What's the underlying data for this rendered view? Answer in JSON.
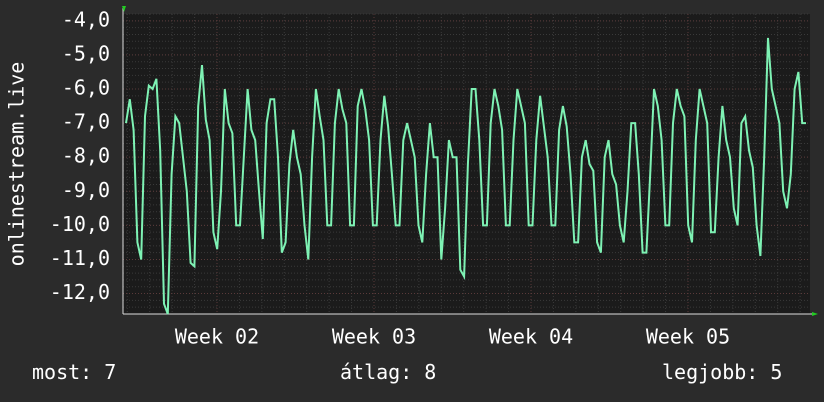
{
  "chart_data": {
    "type": "line",
    "ylabel": "onlinestream.live",
    "yticks": [
      "-4,0",
      "-5,0",
      "-6,0",
      "-7,0",
      "-8,0",
      "-9,0",
      "-10,0",
      "-11,0",
      "-12,0"
    ],
    "ylim": [
      -12.6,
      -3.8
    ],
    "xticks": [
      "Week 02",
      "Week 03",
      "Week 04",
      "Week 05"
    ],
    "grid": true,
    "series": [
      {
        "values": [
          -7,
          -6.3,
          -7.2,
          -10.5,
          -11,
          -6.8,
          -5.9,
          -6,
          -5.7,
          -7.8,
          -12.3,
          -12.6,
          -8.5,
          -6.8,
          -7,
          -8,
          -9,
          -11.1,
          -11.2,
          -6.5,
          -5.3,
          -6.9,
          -7.5,
          -10.2,
          -10.7,
          -9,
          -6,
          -7,
          -7.3,
          -10,
          -10,
          -8,
          -6,
          -7.2,
          -7.5,
          -9,
          -10.4,
          -7,
          -6.3,
          -6.3,
          -8,
          -10.8,
          -10.5,
          -8.2,
          -7.2,
          -8,
          -8.5,
          -10,
          -11,
          -8,
          -6,
          -6.8,
          -7.5,
          -10,
          -10,
          -7,
          -6,
          -6.6,
          -7,
          -10,
          -10,
          -6.5,
          -6,
          -6.6,
          -7.5,
          -10,
          -10,
          -7.5,
          -6.2,
          -7.1,
          -8.5,
          -10,
          -10,
          -7.5,
          -7,
          -7.5,
          -8,
          -10,
          -10.5,
          -8.5,
          -7,
          -8,
          -8,
          -11,
          -9.5,
          -7.5,
          -8,
          -8,
          -11.3,
          -11.5,
          -8.2,
          -6,
          -6,
          -7.5,
          -10,
          -10,
          -7,
          -6,
          -6.5,
          -7.2,
          -10,
          -10,
          -7.5,
          -6,
          -6.5,
          -7,
          -10,
          -10,
          -7.5,
          -6.2,
          -7.1,
          -8,
          -10,
          -10,
          -7.2,
          -6.5,
          -7.1,
          -8.5,
          -10.5,
          -10.5,
          -8,
          -7.5,
          -8.2,
          -8.4,
          -10.5,
          -10.8,
          -8,
          -7.5,
          -8.5,
          -8.8,
          -10,
          -10.5,
          -9,
          -7,
          -7,
          -8.5,
          -10.8,
          -10.8,
          -8.5,
          -6,
          -6.5,
          -7.5,
          -10,
          -10,
          -7,
          -6,
          -6.5,
          -6.8,
          -10,
          -10.5,
          -7.5,
          -6,
          -6.5,
          -7,
          -10.2,
          -10.2,
          -8,
          -6.5,
          -7.5,
          -8,
          -9.5,
          -10,
          -7,
          -6.8,
          -7.8,
          -8.3,
          -10,
          -10.9,
          -8,
          -4.5,
          -6,
          -6.5,
          -7,
          -9,
          -9.5,
          -8.5,
          -6,
          -5.5,
          -7,
          -7
        ]
      }
    ]
  },
  "footer": {
    "now_label": "most:",
    "now_value": "7",
    "avg_label": "átlag:",
    "avg_value": "8",
    "best_label": "legjobb:",
    "best_value": "5"
  },
  "colors": {
    "background": "#2b2b2b",
    "plot_background": "#1b1b1b",
    "grid_major": "#5a3a3a",
    "grid_minor": "#3a3a3a",
    "line": "#7ef2b4",
    "arrow": "#22cc22"
  }
}
